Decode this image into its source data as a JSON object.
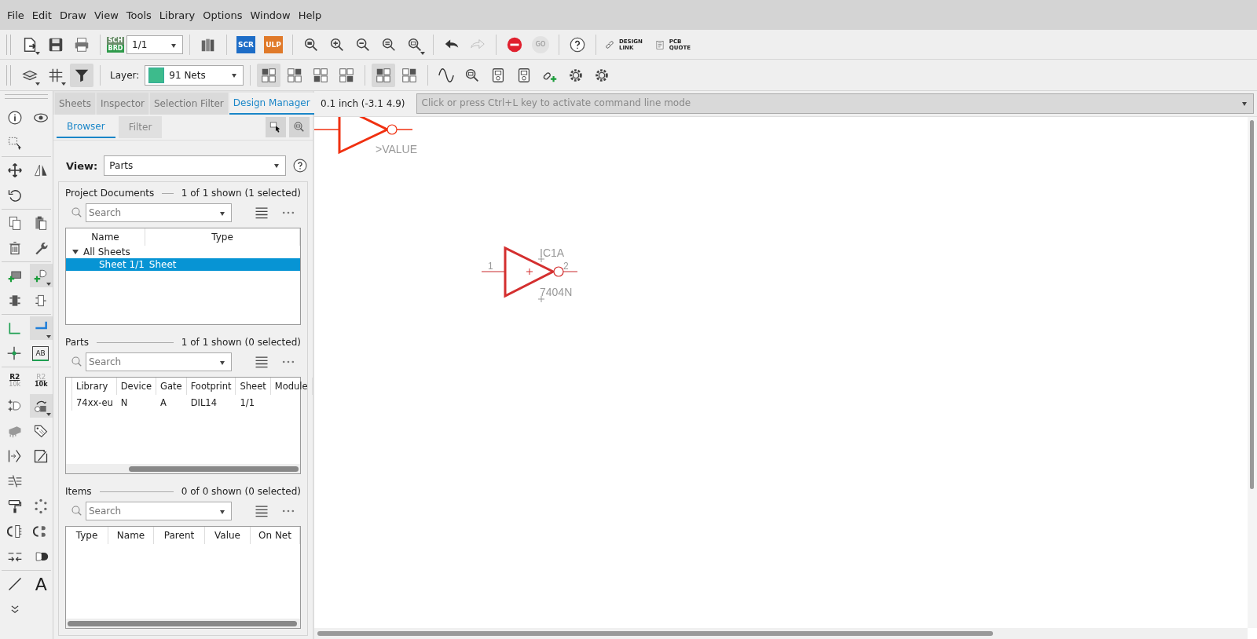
{
  "menu": [
    "File",
    "Edit",
    "Draw",
    "View",
    "Tools",
    "Library",
    "Options",
    "Window",
    "Help"
  ],
  "toolbar": {
    "sch_brd": [
      "SCH",
      "BRD"
    ],
    "sheet": "1/1",
    "scr": "SCR",
    "ulp": "ULP",
    "go": "GO",
    "design_link": [
      "DESIGN",
      "LINK"
    ],
    "pcb_quote": [
      "PCB",
      "QUOTE"
    ]
  },
  "toolbar2": {
    "layer_label": "Layer:",
    "layer": "91 Nets"
  },
  "left_tools": {
    "resistor": [
      "R2",
      "10k"
    ],
    "resistor_alt": [
      "R2",
      "10k"
    ],
    "label": "AB",
    "text": "A"
  },
  "tabs": [
    {
      "label": "Sheets",
      "selected": false
    },
    {
      "label": "Inspector",
      "selected": false
    },
    {
      "label": "Selection Filter",
      "selected": false
    },
    {
      "label": "Design Manager",
      "selected": true
    }
  ],
  "subtabs": [
    {
      "label": "Browser",
      "selected": true
    },
    {
      "label": "Filter",
      "selected": false
    }
  ],
  "view": {
    "label": "View:",
    "value": "Parts"
  },
  "project_documents": {
    "title": "Project Documents",
    "count": "1 of 1 shown (1 selected)",
    "search": {
      "placeholder": "Search"
    },
    "columns": [
      "Name",
      "Type"
    ],
    "tree": [
      {
        "label": "All Sheets",
        "expanded": true,
        "children": [
          {
            "name": "Sheet 1/1",
            "type": "Sheet",
            "selected": true
          }
        ]
      }
    ]
  },
  "parts": {
    "title": "Parts",
    "count": "1 of 1 shown (0 selected)",
    "search": {
      "placeholder": "Search"
    },
    "columns": [
      "Library",
      "Device",
      "Gate",
      "Footprint",
      "Sheet",
      "Module"
    ],
    "rows": [
      {
        "cells": [
          "74xx-eu",
          "N",
          "A",
          "DIL14",
          "1/1"
        ],
        "selected": false
      }
    ]
  },
  "items": {
    "title": "Items",
    "count": "0 of 0 shown (0 selected)",
    "search": {
      "placeholder": "Search"
    },
    "columns": [
      "Type",
      "Name",
      "Parent",
      "Value",
      "On Net"
    ]
  },
  "status": {
    "coordinates": "0.1 inch (-3.1 4.9)",
    "command": {
      "placeholder": "Click or press Ctrl+L key to activate command line mode"
    }
  },
  "canvas": {
    "top_symbol": {
      "value": ">VALUE"
    },
    "gate": {
      "name": "IC1A",
      "value": "7404N",
      "pin_in": "1",
      "pin_out": "2"
    }
  }
}
